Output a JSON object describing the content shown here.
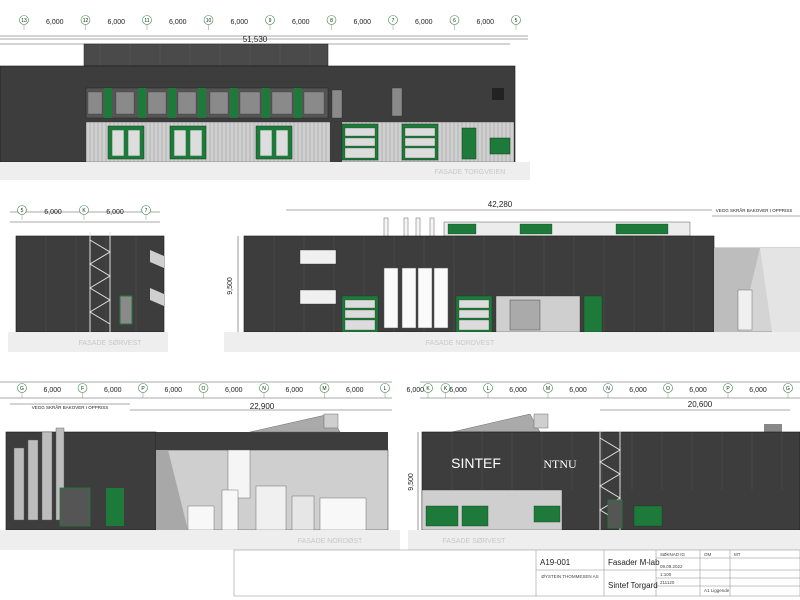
{
  "elevation_1": {
    "grid_top": [
      "13",
      "12",
      "11",
      "10",
      "9",
      "8",
      "7",
      "6",
      "5"
    ],
    "spacings_top": [
      "6,000",
      "6,000",
      "6,000",
      "6,000",
      "6,000",
      "6,000",
      "6,000",
      "6,000"
    ],
    "overall": "51,530",
    "caption": "FASADE TORGVEIEN"
  },
  "elevation_2": {
    "grid_top": [
      "5",
      "K",
      "7"
    ],
    "spacings_top": [
      "6,000",
      "6,000"
    ],
    "caption": "FASADE SØRVEST"
  },
  "elevation_3": {
    "overall": "42,280",
    "note": "VEGG SKRÅR BAKOVER I OPPRISS",
    "height": "9,500",
    "caption": "FASADE NORDVEST"
  },
  "elevation_4": {
    "grid_top": [
      "G",
      "F",
      "P",
      "O",
      "N",
      "M",
      "L",
      "K"
    ],
    "spacings_top": [
      "6,000",
      "6,000",
      "6,000",
      "6,000",
      "6,000",
      "6,000",
      "6,000"
    ],
    "overall": "22,900",
    "note": "VEGG SKRÅR BAKOVER I OPPRISS",
    "caption": "FASADE NORDØST"
  },
  "elevation_5": {
    "grid_top": [
      "K",
      "L",
      "M",
      "N",
      "O",
      "P",
      "G"
    ],
    "spacings_top": [
      "6,000",
      "6,000",
      "6,000",
      "6,000",
      "6,000",
      "6,000"
    ],
    "overall": "20,600",
    "height": "9,500",
    "caption": "FASADE SØRVEST",
    "logo_sintef": "SINTEF",
    "logo_ntnu": "NTNU"
  },
  "title_block": {
    "drawing_no": "A19-001",
    "title": "Fasader M-lab",
    "project": "Sintef Torgard",
    "company": "ØYSTEIN THOMMESEN AS",
    "revision_label": "SØKNAD IG",
    "date": "09.09.2022",
    "scale": "1:100",
    "project_no": "211120",
    "sheet": "A1 Liggende",
    "drawn": "OM",
    "checked": "MT"
  },
  "colors": {
    "facade_dark": "#3d3d3d",
    "window_green": "#1e7a3a",
    "panel_light": "#d4d4d4",
    "ground": "#eeeeee"
  }
}
